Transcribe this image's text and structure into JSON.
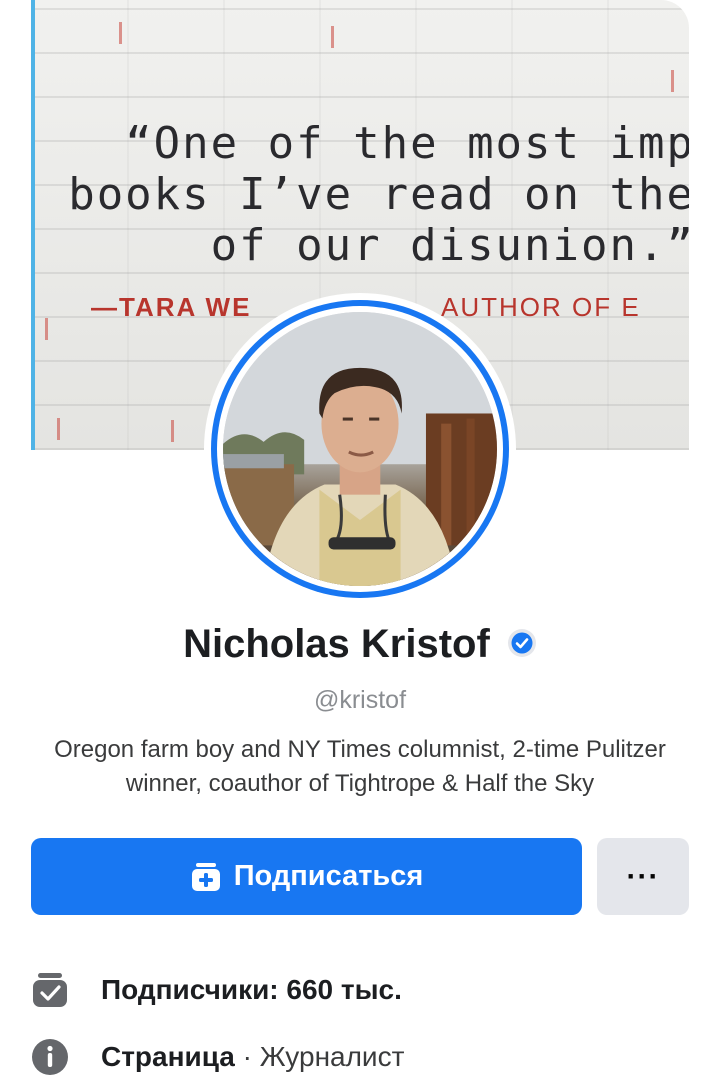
{
  "cover": {
    "quote_lines": [
      "“One of the most imp",
      "books I’ve read on the",
      "of our disunion.”"
    ],
    "attribution": "—TARA WE",
    "attribution_rest": "AUTHOR OF E"
  },
  "profile": {
    "name": "Nicholas Kristof",
    "handle": "@kristof",
    "bio": "Oregon farm boy and NY Times columnist, 2-time Pulitzer winner, coauthor of Tightrope & Half the Sky",
    "verified_icon": "verified-badge-icon"
  },
  "actions": {
    "subscribe_label": "Подписаться",
    "subscribe_icon": "add-subscribe-icon",
    "more_label": "···"
  },
  "info": {
    "followers_label": "Подписчики: 660 тыс.",
    "page_type_label": "Страница",
    "page_separator": " · ",
    "page_category": "Журналист"
  },
  "colors": {
    "accent": "#1877f2",
    "secondary_button": "#e4e6eb",
    "muted_text": "#8a8d91"
  }
}
